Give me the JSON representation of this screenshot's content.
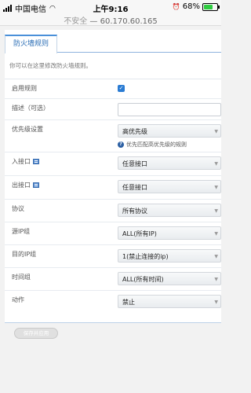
{
  "statusbar": {
    "carrier": "中国电信",
    "time": "上午9:16",
    "battery_pct": "68%",
    "battery_level": 0.68
  },
  "urlbar": {
    "insecure": "不安全",
    "address": "60.170.60.165"
  },
  "tab": {
    "label": "防火墙规则"
  },
  "description": "你可以在这里修改防火墙规则。",
  "form": {
    "enable": {
      "label": "启用规则",
      "checked": true
    },
    "remark": {
      "label": "描述（可选）",
      "value": ""
    },
    "priority": {
      "label": "优先级设置",
      "value": "高优先级",
      "hint": "优先匹配高优先级的规则"
    },
    "in_iface": {
      "label": "入接口",
      "value": "任意接口"
    },
    "out_iface": {
      "label": "出接口",
      "value": "任意接口"
    },
    "protocol": {
      "label": "协议",
      "value": "所有协议"
    },
    "src_ip": {
      "label": "源IP组",
      "value": "ALL(所有IP)"
    },
    "dst_ip": {
      "label": "目的IP组",
      "value": "1(禁止连接的ip)"
    },
    "time_group": {
      "label": "时间组",
      "value": "ALL(所有时间)"
    },
    "action": {
      "label": "动作",
      "value": "禁止"
    }
  },
  "apply_button": {
    "label": "保存并应用"
  }
}
